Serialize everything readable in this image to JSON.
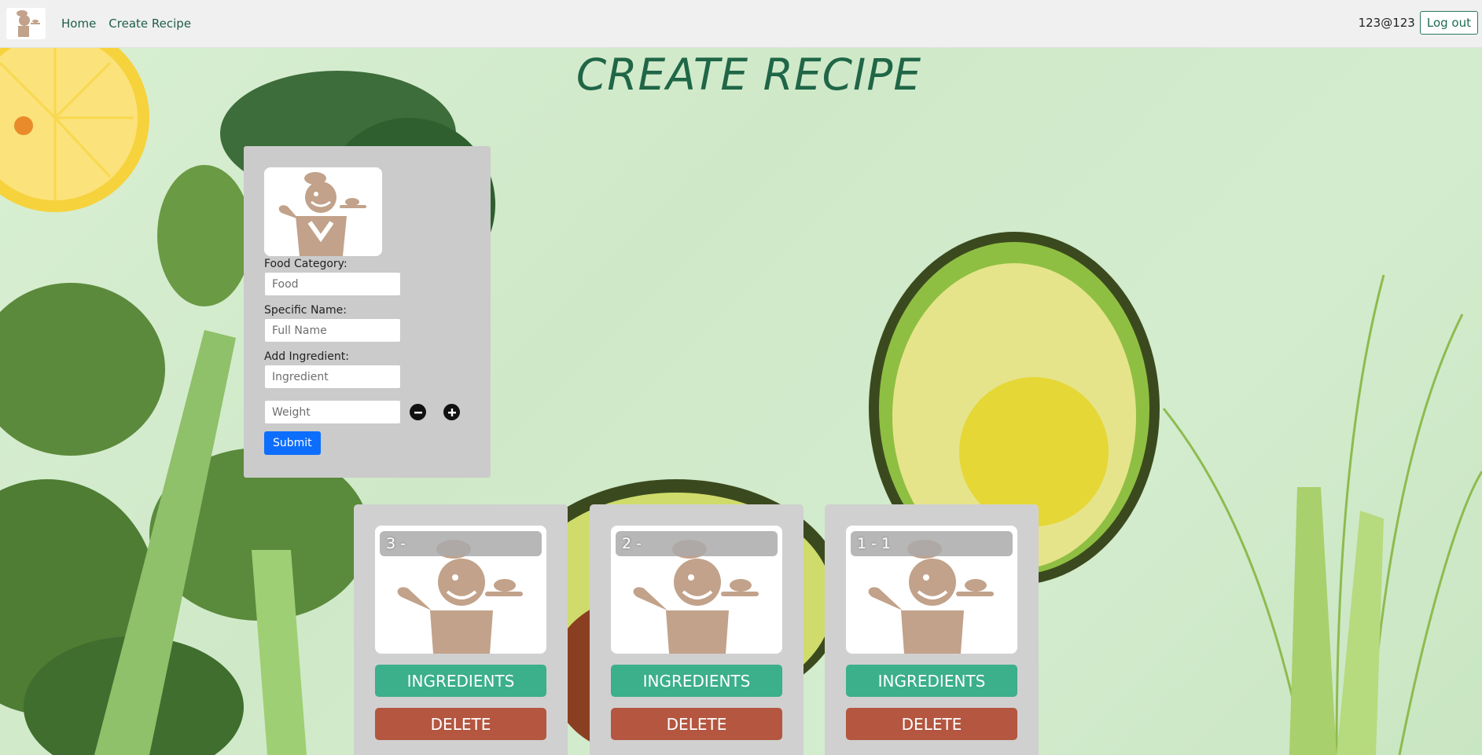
{
  "navbar": {
    "logo_icon": "chef-logo-icon",
    "links": [
      {
        "label": "Home"
      },
      {
        "label": "Create Recipe"
      }
    ],
    "user_email": "123@123",
    "logout_label": "Log out"
  },
  "page": {
    "title": "CREATE RECIPE"
  },
  "form": {
    "image_icon": "chef-icon",
    "category_label": "Food Category:",
    "category_placeholder": "Food",
    "name_label": "Specific Name:",
    "name_placeholder": "Full Name",
    "ingredient_label": "Add Ingredient:",
    "ingredient_placeholder": "Ingredient",
    "weight_placeholder": "Weight",
    "remove_icon": "minus-circle-icon",
    "add_icon": "plus-circle-icon",
    "submit_label": "Submit"
  },
  "recipes": [
    {
      "caption": "3 -",
      "ingredients_label": "INGREDIENTS",
      "delete_label": "DELETE"
    },
    {
      "caption": "2 -",
      "ingredients_label": "INGREDIENTS",
      "delete_label": "DELETE"
    },
    {
      "caption": "1 - 1",
      "ingredients_label": "INGREDIENTS",
      "delete_label": "DELETE"
    }
  ],
  "colors": {
    "nav_link": "#1e5e48",
    "title": "#1f6647",
    "submit": "#0d6efd",
    "ingredients": "#3caf8b",
    "delete": "#b45640",
    "panel": "#cbcbcb"
  }
}
